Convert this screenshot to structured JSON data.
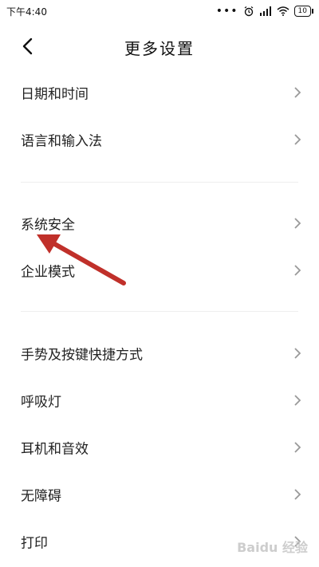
{
  "status": {
    "time": "下午4:40",
    "battery": "10"
  },
  "header": {
    "title": "更多设置"
  },
  "groups": [
    {
      "items": [
        {
          "label": "日期和时间"
        },
        {
          "label": "语言和输入法"
        }
      ]
    },
    {
      "items": [
        {
          "label": "系统安全"
        },
        {
          "label": "企业模式"
        }
      ]
    },
    {
      "items": [
        {
          "label": "手势及按键快捷方式"
        },
        {
          "label": "呼吸灯"
        },
        {
          "label": "耳机和音效"
        },
        {
          "label": "无障碍"
        },
        {
          "label": "打印"
        }
      ]
    }
  ],
  "annotation": {
    "arrow_color": "#c0302a"
  },
  "watermark": "Baidu 经验"
}
